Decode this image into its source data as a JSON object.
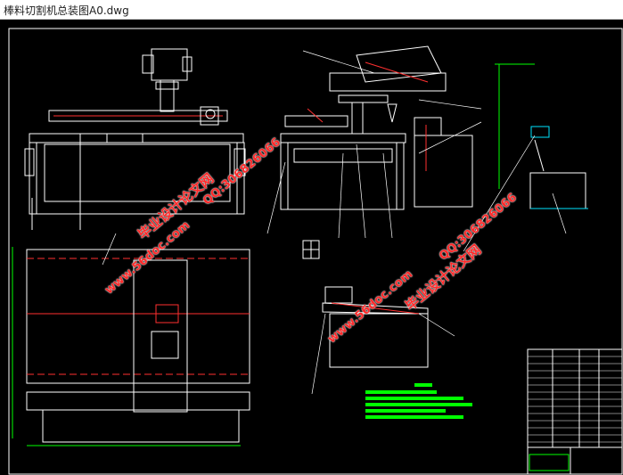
{
  "window": {
    "title": "棒料切割机总装图A0.dwg"
  },
  "watermarks": [
    {
      "text": "毕业设计论文网",
      "color": "#ff2020"
    },
    {
      "text": "www.56doc.com",
      "color": "#ff2020"
    },
    {
      "text": "QQ:306826066",
      "color": "#ff2020"
    },
    {
      "text": "www.56doc.com",
      "color": "#ff2020"
    },
    {
      "text": "QQ:306826066",
      "color": "#ff2020"
    },
    {
      "text": "毕业设计论文网",
      "color": "#ff2020"
    }
  ],
  "colors": {
    "background": "#000000",
    "line_white": "#ffffff",
    "line_green": "#00ff00",
    "line_red": "#ff3030",
    "line_cyan": "#00e5ff",
    "line_yellow": "#ffff00",
    "line_magenta": "#ff40ff"
  }
}
